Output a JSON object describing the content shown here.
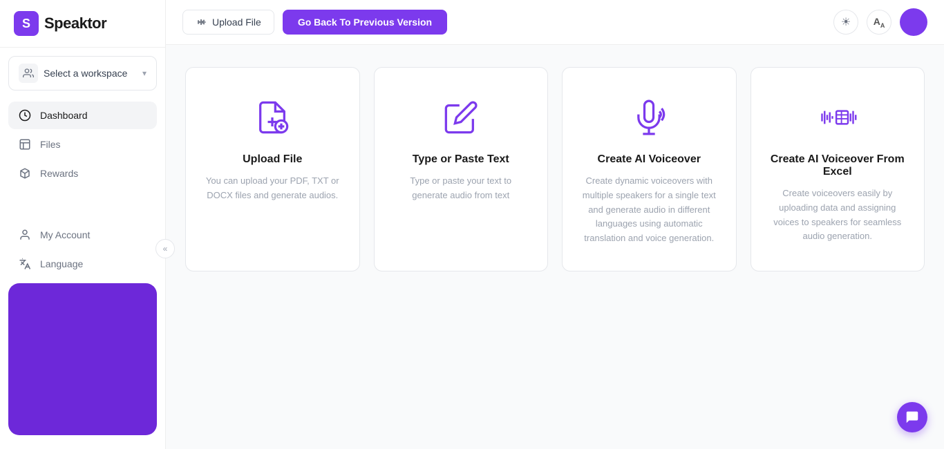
{
  "logo": {
    "letter": "S",
    "name": "Speaktor"
  },
  "sidebar": {
    "workspace": {
      "label": "Select a workspace",
      "chevron": "▾"
    },
    "nav_items": [
      {
        "id": "dashboard",
        "label": "Dashboard",
        "active": true
      },
      {
        "id": "files",
        "label": "Files",
        "active": false
      },
      {
        "id": "rewards",
        "label": "Rewards",
        "active": false
      }
    ],
    "bottom_items": [
      {
        "id": "my-account",
        "label": "My Account"
      },
      {
        "id": "language",
        "label": "Language"
      }
    ],
    "collapse_label": "«"
  },
  "header": {
    "upload_button": "Upload File",
    "go_back_button": "Go Back To Previous Version",
    "theme_icon": "☀",
    "translate_icon": "A"
  },
  "cards": [
    {
      "id": "upload-file",
      "title": "Upload File",
      "description": "You can upload your PDF, TXT or DOCX files and generate audios."
    },
    {
      "id": "type-paste-text",
      "title": "Type or Paste Text",
      "description": "Type or paste your text to generate audio from text"
    },
    {
      "id": "create-ai-voiceover",
      "title": "Create AI Voiceover",
      "description": "Create dynamic voiceovers with multiple speakers for a single text and generate audio in different languages using automatic translation and voice generation."
    },
    {
      "id": "create-ai-voiceover-excel",
      "title": "Create AI Voiceover From Excel",
      "description": "Create voiceovers easily by uploading data and assigning voices to speakers for seamless audio generation."
    }
  ],
  "colors": {
    "purple": "#7c3aed",
    "purple_dark": "#6d28d9"
  }
}
